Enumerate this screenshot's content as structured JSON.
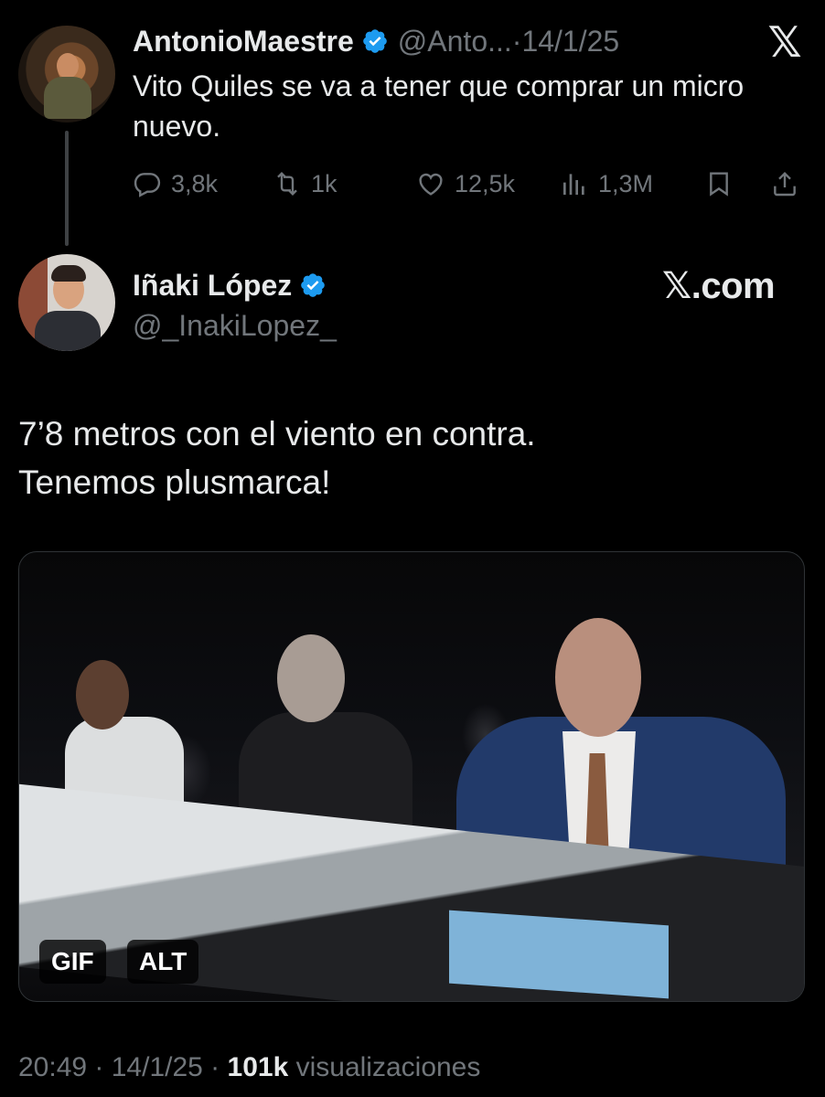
{
  "parent_tweet": {
    "display_name": "AntonioMaestre",
    "handle": "@Anto...",
    "separator": " · ",
    "date": "14/1/25",
    "text": "Vito Quiles se va a tener que comprar un micro nuevo.",
    "verified": true,
    "actions": {
      "replies": "3,8k",
      "retweets": "1k",
      "likes": "12,5k",
      "views": "1,3M"
    }
  },
  "brand": {
    "x_logo": "𝕏",
    "watermark": "𝕏.com"
  },
  "main_tweet": {
    "display_name": "Iñaki López",
    "handle": "@_InakiLopez_",
    "verified": true,
    "text_line1": "7’8 metros con el viento en contra.",
    "text_line2": "Tenemos plusmarca!",
    "media": {
      "gif_badge": "GIF",
      "alt_badge": "ALT"
    },
    "footer": {
      "time": "20:49",
      "sep1": " · ",
      "date": "14/1/25",
      "sep2": " · ",
      "views": "101k",
      "views_label": " visualizaciones"
    }
  },
  "colors": {
    "background": "#000000",
    "text": "#e7e9ea",
    "secondary_text": "#71767b",
    "verified_blue": "#1d9bf0"
  },
  "icons": [
    "reply-icon",
    "retweet-icon",
    "like-icon",
    "views-icon",
    "bookmark-icon",
    "share-icon",
    "verified-badge-icon",
    "x-logo-icon"
  ]
}
